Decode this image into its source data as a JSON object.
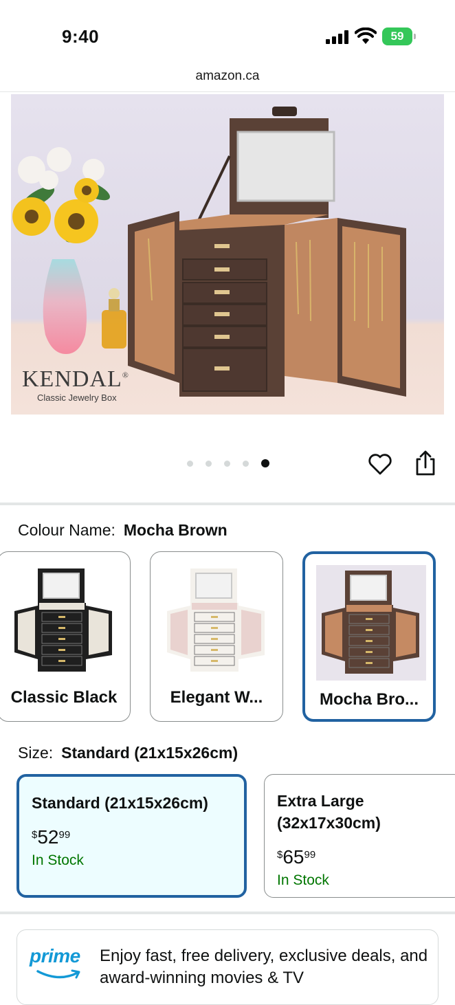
{
  "status_bar": {
    "time": "9:40",
    "battery": "59"
  },
  "url": "amazon.ca",
  "hero": {
    "brand": "KENDAL",
    "brand_mark": "®",
    "subtitle": "Classic Jewelry Box",
    "carousel": {
      "count": 5,
      "active_index": 5
    }
  },
  "colour": {
    "label": "Colour Name:",
    "selected": "Mocha Brown",
    "options": [
      {
        "name": "Classic Black",
        "body": "#1f1f1f",
        "lining": "#e9e4da",
        "bg": "#ffffff"
      },
      {
        "name": "Elegant W...",
        "body": "#f4f1ec",
        "lining": "#e9d2cf",
        "bg": "#ffffff"
      },
      {
        "name": "Mocha Bro...",
        "body": "#5a4136",
        "lining": "#c58a63",
        "bg": "#e8e4ec"
      }
    ]
  },
  "size": {
    "label": "Size:",
    "selected": "Standard (21x15x26cm)",
    "options": [
      {
        "name": "Standard (21x15x26cm)",
        "currency": "$",
        "price_whole": "52",
        "price_frac": "99",
        "stock": "In Stock"
      },
      {
        "name": "Extra Large (32x17x30cm)",
        "currency": "$",
        "price_whole": "65",
        "price_frac": "99",
        "stock": "In Stock"
      }
    ]
  },
  "prime": {
    "logo": "prime",
    "text": "Enjoy fast, free delivery, exclusive deals, and award-winning movies & TV"
  },
  "colors": {
    "accent": "#2162a1",
    "stock": "#007600",
    "prime": "#1399d6",
    "selected_bg": "#edfdff"
  }
}
